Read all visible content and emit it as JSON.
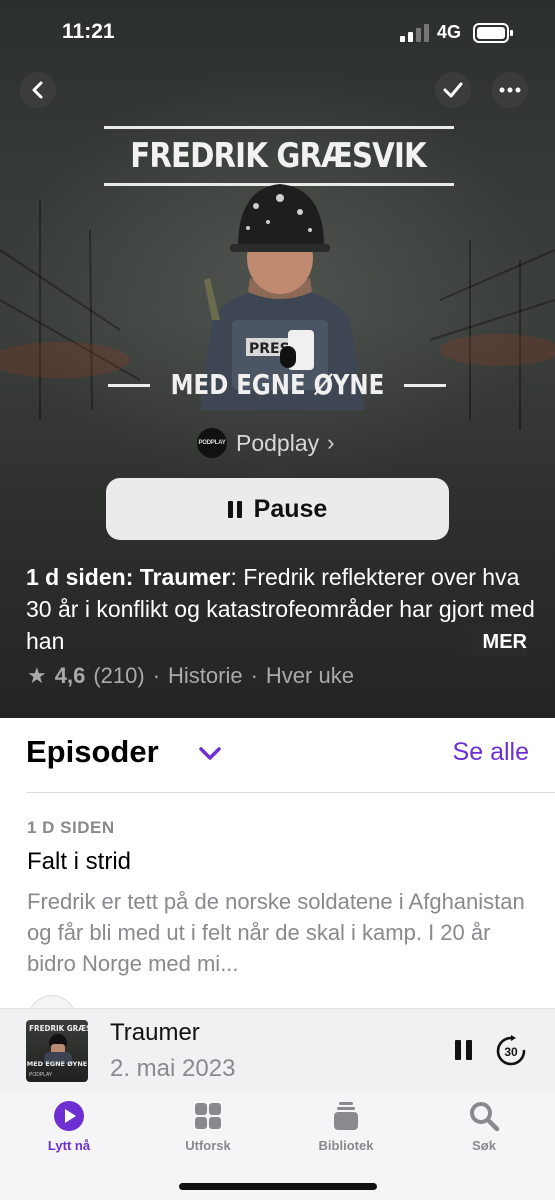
{
  "status_bar": {
    "time": "11:21",
    "network": "4G",
    "icons": [
      "signal-icon",
      "battery-icon"
    ]
  },
  "nav": {
    "icons": [
      "back-chevron-icon",
      "checkmark-icon",
      "more-ellipsis-icon"
    ]
  },
  "artwork": {
    "title": "FREDRIK GRÆSVIK",
    "subtitle": "MED EGNE ØYNE",
    "helmet_text": "PRES"
  },
  "publisher": {
    "logo_text": "PODPLAY",
    "name": "Podplay",
    "chevron": "›"
  },
  "play_control": {
    "label": "Pause",
    "icon": "pause-icon"
  },
  "latest_episode": {
    "age_title": "1 d siden: Traumer",
    "text": ": Fredrik reflekterer over hva 30 år i konflikt og katastrofeområder har gjort med han",
    "more_label": "MER"
  },
  "meta": {
    "star": "★",
    "rating": "4,6",
    "count": "(210)",
    "sep": "·",
    "category": "Historie",
    "frequency": "Hver uke"
  },
  "episodes": {
    "heading": "Episoder",
    "see_all": "Se alle",
    "items": [
      {
        "date": "1 D SIDEN",
        "title": "Falt i strid",
        "description": "Fredrik er tett på de norske soldatene i Afghanistan og får bli med ut i felt når de skal i kamp. I 20 år bidro Norge med mi..."
      }
    ]
  },
  "mini_player": {
    "title": "Traumer",
    "date": "2. mai 2023",
    "art_title": "FREDRIK GRÆSVIK",
    "art_subtitle": "MED EGNE ØYNE",
    "art_publisher": "PODPLAY",
    "skip_label": "30"
  },
  "tab_bar": {
    "tabs": [
      {
        "label": "Lytt nå",
        "icon": "play-circle-icon",
        "active": true
      },
      {
        "label": "Utforsk",
        "icon": "grid-icon",
        "active": false
      },
      {
        "label": "Bibliotek",
        "icon": "library-stack-icon",
        "active": false
      },
      {
        "label": "Søk",
        "icon": "search-icon",
        "active": false
      }
    ]
  },
  "colors": {
    "accent": "#6e2fd2",
    "hero_bg": "#2e312e",
    "secondary_text": "#8a8a8e"
  }
}
